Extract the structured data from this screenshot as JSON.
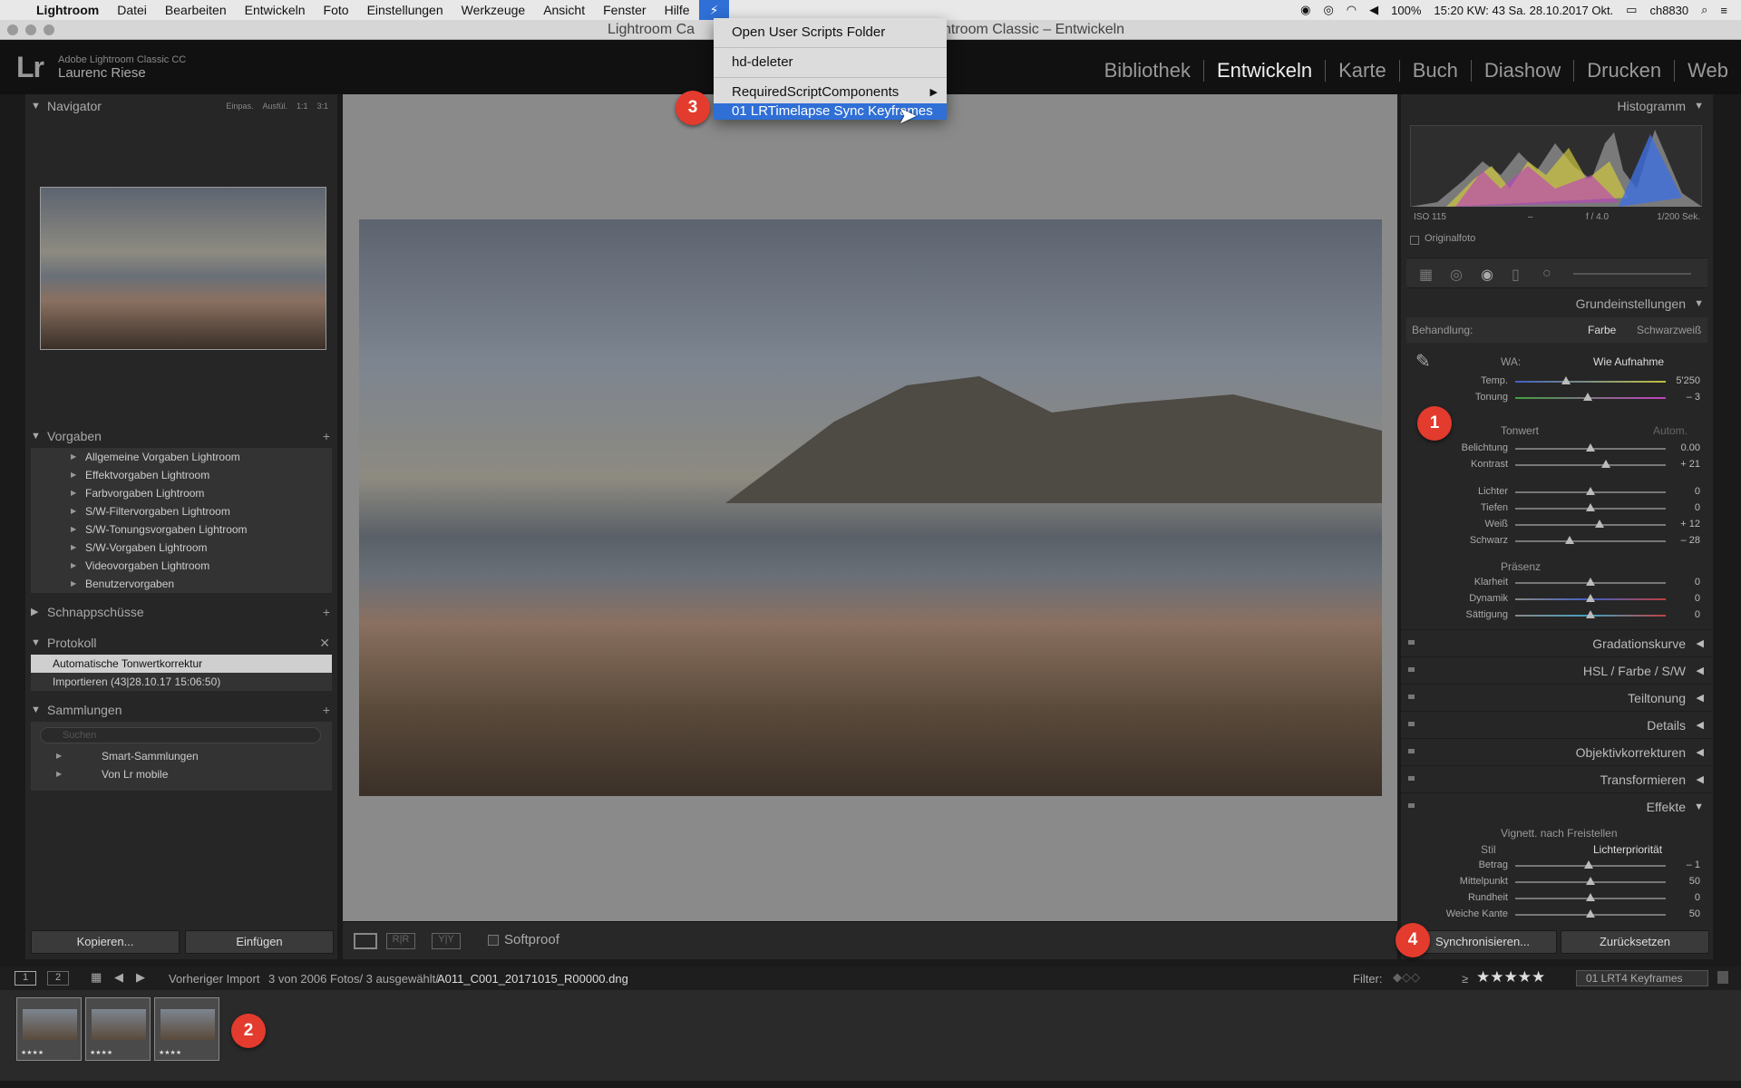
{
  "menubar": {
    "app": "Lightroom",
    "items": [
      "Datei",
      "Bearbeiten",
      "Entwickeln",
      "Foto",
      "Einstellungen",
      "Werkzeuge",
      "Ansicht",
      "Fenster",
      "Hilfe"
    ],
    "battery": "100%",
    "clock": "15:20 KW: 43 Sa. 28.10.2017 Okt.",
    "user": "ch8830"
  },
  "window": {
    "title_left": "Lightroom Ca",
    "title_right": "htroom Classic – Entwickeln"
  },
  "identity": {
    "line1": "Adobe Lightroom Classic CC",
    "line2": "Laurenc Riese",
    "logo": "Lr"
  },
  "modules": [
    "Bibliothek",
    "Entwickeln",
    "Karte",
    "Buch",
    "Diashow",
    "Drucken",
    "Web"
  ],
  "dropdown": {
    "items": [
      "Open User Scripts Folder",
      "hd-deleter",
      "RequiredScriptComponents",
      "01 LRTimelapse Sync Keyframes"
    ]
  },
  "navigator": {
    "title": "Navigator",
    "zoom": [
      "Einpas.",
      "Ausfül.",
      "1:1",
      "3:1"
    ]
  },
  "presets": {
    "title": "Vorgaben",
    "items": [
      "Allgemeine Vorgaben Lightroom",
      "Effektvorgaben Lightroom",
      "Farbvorgaben Lightroom",
      "S/W-Filtervorgaben Lightroom",
      "S/W-Tonungsvorgaben Lightroom",
      "S/W-Vorgaben Lightroom",
      "Videovorgaben Lightroom",
      "Benutzervorgaben"
    ]
  },
  "snapshots": {
    "title": "Schnappschüsse"
  },
  "history": {
    "title": "Protokoll",
    "items": [
      "Automatische Tonwertkorrektur",
      "Importieren (43|28.10.17 15:06:50)"
    ]
  },
  "collections": {
    "title": "Sammlungen",
    "search_placeholder": "Suchen",
    "items": [
      "Smart-Sammlungen",
      "Von Lr mobile"
    ]
  },
  "left_buttons": {
    "copy": "Kopieren...",
    "paste": "Einfügen"
  },
  "toolbar": {
    "softproof": "Softproof"
  },
  "histogram": {
    "title": "Histogramm",
    "iso": "ISO 115",
    "dash": "–",
    "aperture": "f / 4.0",
    "shutter": "1/200 Sek.",
    "original": "Originalfoto"
  },
  "basic": {
    "title": "Grundeinstellungen",
    "treatment_label": "Behandlung:",
    "color": "Farbe",
    "bw": "Schwarzweiß",
    "wb_label": "WA:",
    "wb_value": "Wie Aufnahme",
    "tone_label": "Tonwert",
    "auto": "Autom.",
    "presence_label": "Präsenz",
    "sliders": [
      {
        "label": "Temp.",
        "value": "5'250",
        "pos": 0.34
      },
      {
        "label": "Tonung",
        "value": "– 3",
        "pos": 0.48
      },
      {
        "label": "Belichtung",
        "value": "0.00",
        "pos": 0.5
      },
      {
        "label": "Kontrast",
        "value": "+ 21",
        "pos": 0.6
      },
      {
        "label": "Lichter",
        "value": "0",
        "pos": 0.5
      },
      {
        "label": "Tiefen",
        "value": "0",
        "pos": 0.5
      },
      {
        "label": "Weiß",
        "value": "+ 12",
        "pos": 0.56
      },
      {
        "label": "Schwarz",
        "value": "– 28",
        "pos": 0.36
      },
      {
        "label": "Klarheit",
        "value": "0",
        "pos": 0.5
      },
      {
        "label": "Dynamik",
        "value": "0",
        "pos": 0.5
      },
      {
        "label": "Sättigung",
        "value": "0",
        "pos": 0.5
      }
    ]
  },
  "sections": [
    "Gradationskurve",
    "HSL  /  Farbe  /  S/W",
    "Teiltonung",
    "Details",
    "Objektivkorrekturen",
    "Transformieren",
    "Effekte"
  ],
  "effects": {
    "vignette": "Vignett. nach Freistellen",
    "style_label": "Stil",
    "style_value": "Lichterpriorität",
    "sliders": [
      {
        "label": "Betrag",
        "value": "– 1",
        "pos": 0.49
      },
      {
        "label": "Mittelpunkt",
        "value": "50",
        "pos": 0.5
      },
      {
        "label": "Rundheit",
        "value": "0",
        "pos": 0.5
      },
      {
        "label": "Weiche Kante",
        "value": "50",
        "pos": 0.5
      }
    ]
  },
  "right_buttons": {
    "sync": "Synchronisieren...",
    "reset": "Zurücksetzen"
  },
  "filmstrip": {
    "page1": "1",
    "page2": "2",
    "source": "Vorheriger Import",
    "count": "3 von 2006 Fotos/ 3 ausgewählt/",
    "filename": "A011_C001_20171015_R00000.dng",
    "filter_label": "Filter:",
    "gte": "≥",
    "rating": "★★★★★",
    "filter_preset": "01 LRT4 Keyframes",
    "thumb_stars": "★★★★"
  },
  "badges": [
    "1",
    "2",
    "3",
    "4"
  ]
}
